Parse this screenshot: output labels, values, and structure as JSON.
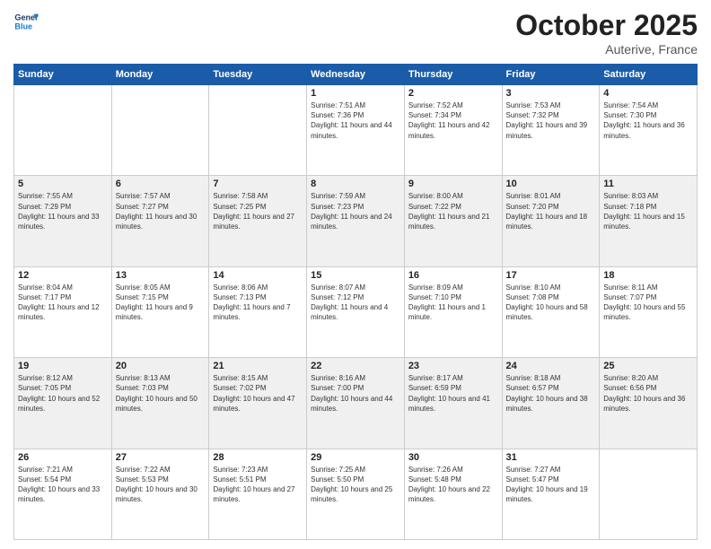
{
  "header": {
    "logo_line1": "General",
    "logo_line2": "Blue",
    "month": "October 2025",
    "location": "Auterive, France"
  },
  "weekdays": [
    "Sunday",
    "Monday",
    "Tuesday",
    "Wednesday",
    "Thursday",
    "Friday",
    "Saturday"
  ],
  "weeks": [
    [
      {
        "day": "",
        "sunrise": "",
        "sunset": "",
        "daylight": ""
      },
      {
        "day": "",
        "sunrise": "",
        "sunset": "",
        "daylight": ""
      },
      {
        "day": "",
        "sunrise": "",
        "sunset": "",
        "daylight": ""
      },
      {
        "day": "1",
        "sunrise": "Sunrise: 7:51 AM",
        "sunset": "Sunset: 7:36 PM",
        "daylight": "Daylight: 11 hours and 44 minutes."
      },
      {
        "day": "2",
        "sunrise": "Sunrise: 7:52 AM",
        "sunset": "Sunset: 7:34 PM",
        "daylight": "Daylight: 11 hours and 42 minutes."
      },
      {
        "day": "3",
        "sunrise": "Sunrise: 7:53 AM",
        "sunset": "Sunset: 7:32 PM",
        "daylight": "Daylight: 11 hours and 39 minutes."
      },
      {
        "day": "4",
        "sunrise": "Sunrise: 7:54 AM",
        "sunset": "Sunset: 7:30 PM",
        "daylight": "Daylight: 11 hours and 36 minutes."
      }
    ],
    [
      {
        "day": "5",
        "sunrise": "Sunrise: 7:55 AM",
        "sunset": "Sunset: 7:29 PM",
        "daylight": "Daylight: 11 hours and 33 minutes."
      },
      {
        "day": "6",
        "sunrise": "Sunrise: 7:57 AM",
        "sunset": "Sunset: 7:27 PM",
        "daylight": "Daylight: 11 hours and 30 minutes."
      },
      {
        "day": "7",
        "sunrise": "Sunrise: 7:58 AM",
        "sunset": "Sunset: 7:25 PM",
        "daylight": "Daylight: 11 hours and 27 minutes."
      },
      {
        "day": "8",
        "sunrise": "Sunrise: 7:59 AM",
        "sunset": "Sunset: 7:23 PM",
        "daylight": "Daylight: 11 hours and 24 minutes."
      },
      {
        "day": "9",
        "sunrise": "Sunrise: 8:00 AM",
        "sunset": "Sunset: 7:22 PM",
        "daylight": "Daylight: 11 hours and 21 minutes."
      },
      {
        "day": "10",
        "sunrise": "Sunrise: 8:01 AM",
        "sunset": "Sunset: 7:20 PM",
        "daylight": "Daylight: 11 hours and 18 minutes."
      },
      {
        "day": "11",
        "sunrise": "Sunrise: 8:03 AM",
        "sunset": "Sunset: 7:18 PM",
        "daylight": "Daylight: 11 hours and 15 minutes."
      }
    ],
    [
      {
        "day": "12",
        "sunrise": "Sunrise: 8:04 AM",
        "sunset": "Sunset: 7:17 PM",
        "daylight": "Daylight: 11 hours and 12 minutes."
      },
      {
        "day": "13",
        "sunrise": "Sunrise: 8:05 AM",
        "sunset": "Sunset: 7:15 PM",
        "daylight": "Daylight: 11 hours and 9 minutes."
      },
      {
        "day": "14",
        "sunrise": "Sunrise: 8:06 AM",
        "sunset": "Sunset: 7:13 PM",
        "daylight": "Daylight: 11 hours and 7 minutes."
      },
      {
        "day": "15",
        "sunrise": "Sunrise: 8:07 AM",
        "sunset": "Sunset: 7:12 PM",
        "daylight": "Daylight: 11 hours and 4 minutes."
      },
      {
        "day": "16",
        "sunrise": "Sunrise: 8:09 AM",
        "sunset": "Sunset: 7:10 PM",
        "daylight": "Daylight: 11 hours and 1 minute."
      },
      {
        "day": "17",
        "sunrise": "Sunrise: 8:10 AM",
        "sunset": "Sunset: 7:08 PM",
        "daylight": "Daylight: 10 hours and 58 minutes."
      },
      {
        "day": "18",
        "sunrise": "Sunrise: 8:11 AM",
        "sunset": "Sunset: 7:07 PM",
        "daylight": "Daylight: 10 hours and 55 minutes."
      }
    ],
    [
      {
        "day": "19",
        "sunrise": "Sunrise: 8:12 AM",
        "sunset": "Sunset: 7:05 PM",
        "daylight": "Daylight: 10 hours and 52 minutes."
      },
      {
        "day": "20",
        "sunrise": "Sunrise: 8:13 AM",
        "sunset": "Sunset: 7:03 PM",
        "daylight": "Daylight: 10 hours and 50 minutes."
      },
      {
        "day": "21",
        "sunrise": "Sunrise: 8:15 AM",
        "sunset": "Sunset: 7:02 PM",
        "daylight": "Daylight: 10 hours and 47 minutes."
      },
      {
        "day": "22",
        "sunrise": "Sunrise: 8:16 AM",
        "sunset": "Sunset: 7:00 PM",
        "daylight": "Daylight: 10 hours and 44 minutes."
      },
      {
        "day": "23",
        "sunrise": "Sunrise: 8:17 AM",
        "sunset": "Sunset: 6:59 PM",
        "daylight": "Daylight: 10 hours and 41 minutes."
      },
      {
        "day": "24",
        "sunrise": "Sunrise: 8:18 AM",
        "sunset": "Sunset: 6:57 PM",
        "daylight": "Daylight: 10 hours and 38 minutes."
      },
      {
        "day": "25",
        "sunrise": "Sunrise: 8:20 AM",
        "sunset": "Sunset: 6:56 PM",
        "daylight": "Daylight: 10 hours and 36 minutes."
      }
    ],
    [
      {
        "day": "26",
        "sunrise": "Sunrise: 7:21 AM",
        "sunset": "Sunset: 5:54 PM",
        "daylight": "Daylight: 10 hours and 33 minutes."
      },
      {
        "day": "27",
        "sunrise": "Sunrise: 7:22 AM",
        "sunset": "Sunset: 5:53 PM",
        "daylight": "Daylight: 10 hours and 30 minutes."
      },
      {
        "day": "28",
        "sunrise": "Sunrise: 7:23 AM",
        "sunset": "Sunset: 5:51 PM",
        "daylight": "Daylight: 10 hours and 27 minutes."
      },
      {
        "day": "29",
        "sunrise": "Sunrise: 7:25 AM",
        "sunset": "Sunset: 5:50 PM",
        "daylight": "Daylight: 10 hours and 25 minutes."
      },
      {
        "day": "30",
        "sunrise": "Sunrise: 7:26 AM",
        "sunset": "Sunset: 5:48 PM",
        "daylight": "Daylight: 10 hours and 22 minutes."
      },
      {
        "day": "31",
        "sunrise": "Sunrise: 7:27 AM",
        "sunset": "Sunset: 5:47 PM",
        "daylight": "Daylight: 10 hours and 19 minutes."
      },
      {
        "day": "",
        "sunrise": "",
        "sunset": "",
        "daylight": ""
      }
    ]
  ]
}
